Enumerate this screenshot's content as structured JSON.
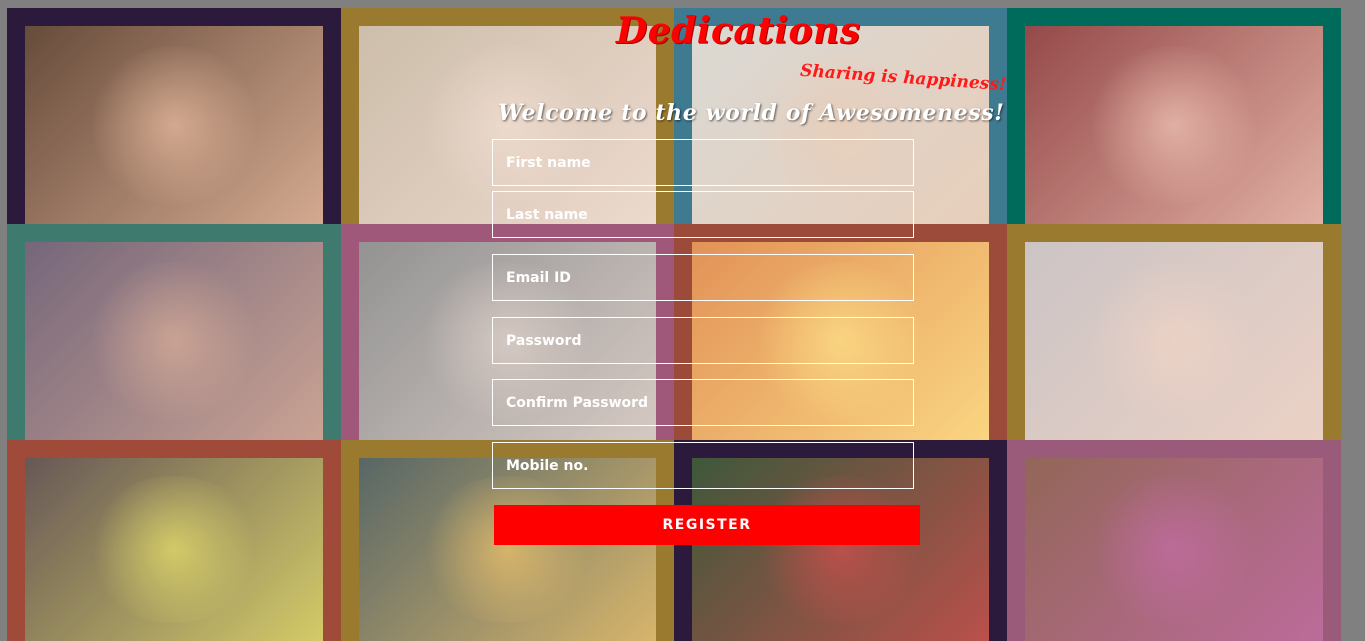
{
  "brand": {
    "title": "Dedications",
    "tagline": "Sharing is happiness!",
    "welcome": "Welcome to the world of Awesomeness!"
  },
  "form": {
    "first_name": "First name",
    "last_name": "Last name",
    "email": "Email ID",
    "password": "Password",
    "confirm_password": "Confirm Password",
    "mobile": "Mobile no.",
    "register": "REGISTER"
  },
  "tiles": [
    {
      "name": "photo-laughing-girl",
      "frame": "#2c1a3c",
      "bg": "#5a3d2a",
      "accent": "#e9b79a"
    },
    {
      "name": "photo-girls-playing",
      "frame": "#9a7a2e",
      "bg": "#c9b8a4",
      "accent": "#f2ddd0"
    },
    {
      "name": "photo-couple-sofa",
      "frame": "#3e7a90",
      "bg": "#d8d6d0",
      "accent": "#e8c8b0"
    },
    {
      "name": "photo-grandfather-child",
      "frame": "#006b5a",
      "bg": "#8c3a3a",
      "accent": "#f0c0b0"
    },
    {
      "name": "photo-couple-smiling",
      "frame": "#3f7a6e",
      "bg": "#6a5a70",
      "accent": "#d8a890"
    },
    {
      "name": "photo-elderly-care",
      "frame": "#a0587a",
      "bg": "#8a8a8a",
      "accent": "#e0d0c8"
    },
    {
      "name": "photo-sunset-freedom",
      "frame": "#9c4a3a",
      "bg": "#e08a4a",
      "accent": "#ffe080"
    },
    {
      "name": "photo-family-circle",
      "frame": "#9a7a2e",
      "bg": "#c8c0c0",
      "accent": "#f0d0c0"
    },
    {
      "name": "photo-kids-yellow-shirts",
      "frame": "#a04a3a",
      "bg": "#5a4a48",
      "accent": "#e8e060"
    },
    {
      "name": "photo-kids-classroom",
      "frame": "#9a7a2e",
      "bg": "#4a5a5a",
      "accent": "#f0c060"
    },
    {
      "name": "photo-girl-flower-crown",
      "frame": "#2c1a3c",
      "bg": "#2e4a2a",
      "accent": "#d04040"
    },
    {
      "name": "photo-group-friends",
      "frame": "#9a5a7a",
      "bg": "#8a5a4a",
      "accent": "#c060a0"
    }
  ]
}
